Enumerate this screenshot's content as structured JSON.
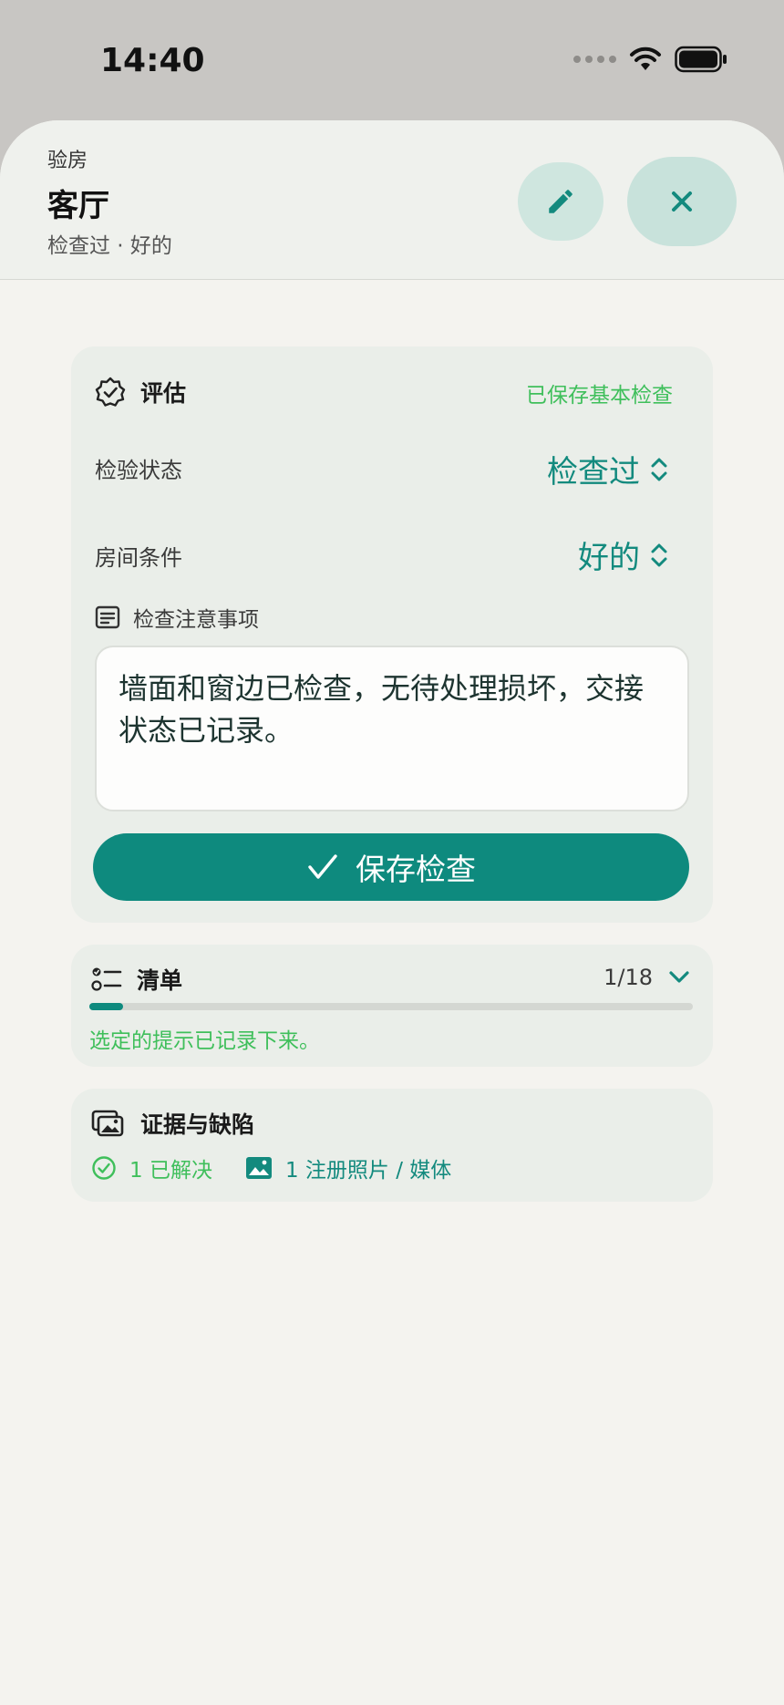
{
  "status_bar": {
    "time": "14:40"
  },
  "header": {
    "eyebrow": "验房",
    "title": "客厅",
    "subtitle": "检查过 · 好的"
  },
  "assessment": {
    "title": "评估",
    "saved_tag": "已保存基本检查",
    "inspection_status": {
      "label": "检验状态",
      "value": "检查过"
    },
    "room_condition": {
      "label": "房间条件",
      "value": "好的"
    },
    "notes": {
      "label": "检查注意事项",
      "value": "墙面和窗边已检查，无待处理损坏，交接状态已记录。"
    },
    "save_label": "保存检查"
  },
  "checklist": {
    "title": "清单",
    "count": "1/18",
    "progress": 0.056,
    "note": "选定的提示已记录下来。"
  },
  "evidence": {
    "title": "证据与缺陷",
    "resolved": "1 已解决",
    "media": "1 注册照片 / 媒体"
  },
  "colors": {
    "accent": "#0e8a7e",
    "success": "#3fbf5b",
    "sheet_bg": "#f4f3ef",
    "card_bg": "#eaeee9"
  }
}
